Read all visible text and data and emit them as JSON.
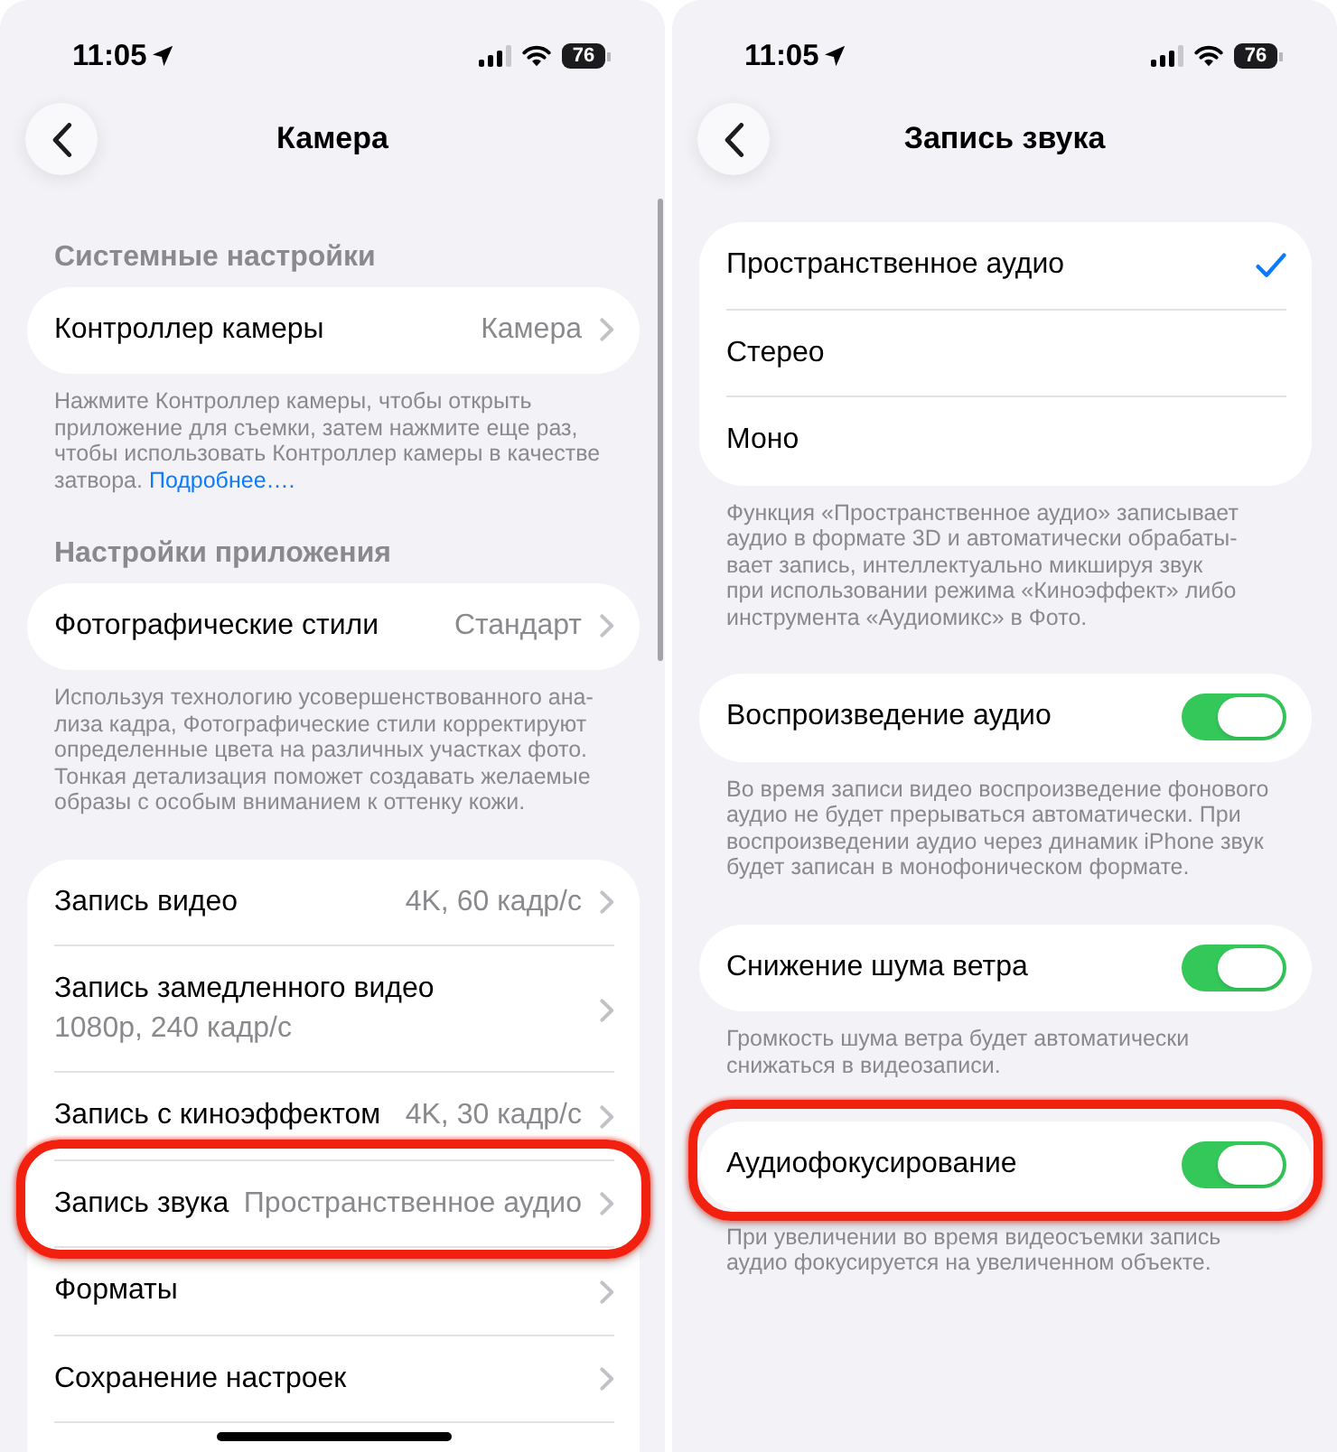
{
  "screens": [
    {
      "status_bar": {
        "time": "11:05",
        "battery": "76"
      },
      "nav": {
        "title": "Камера"
      },
      "groups": [
        {
          "header": "Системные настройки",
          "rows": [
            {
              "kind": "disclosure",
              "label": "Контроллер камеры",
              "value": "Камера",
              "highlighted": false
            }
          ],
          "footer": {
            "text": "Нажмите Контроллер камеры, чтобы открыть\nприложение для съемки, затем нажмите еще раз,\nчтобы использовать Контроллер камеры в качестве\nзатвора.",
            "link": "Подробнее…."
          }
        },
        {
          "header": "Настройки приложения",
          "rows": [
            {
              "kind": "disclosure",
              "label": "Фотографические стили",
              "value": "Стандарт",
              "highlighted": false
            }
          ],
          "footer": {
            "text": "Используя технологию усовершенствованного ана-\nлиза кадра, Фотографические стили корректируют\nопределенные цвета на различных участках фото.\nТонкая детализация поможет создавать желаемые\nобразы с особым вниманием к оттенку кожи."
          }
        },
        {
          "rows": [
            {
              "kind": "disclosure",
              "label": "Запись видео",
              "value": "4K, 60 кадр/с",
              "highlighted": false
            },
            {
              "kind": "disclosure",
              "label": "Запись замедленного видео",
              "detail": "1080p, 240 кадр/с",
              "highlighted": false
            },
            {
              "kind": "disclosure",
              "label": "Запись с киноэффектом",
              "value": "4K, 30 кадр/с",
              "highlighted": false
            },
            {
              "kind": "disclosure",
              "label": "Запись звука",
              "value": "Пространственное аудио",
              "highlighted": true
            },
            {
              "kind": "disclosure",
              "label": "Форматы",
              "highlighted": false
            },
            {
              "kind": "disclosure",
              "label": "Сохранение настроек",
              "highlighted": false
            }
          ]
        }
      ]
    },
    {
      "status_bar": {
        "time": "11:05",
        "battery": "76"
      },
      "nav": {
        "title": "Запись звука"
      },
      "groups": [
        {
          "rows": [
            {
              "kind": "option",
              "label": "Пространственное аудио",
              "selected": true,
              "highlighted": false
            },
            {
              "kind": "option",
              "label": "Стерео",
              "selected": false,
              "highlighted": false
            },
            {
              "kind": "option",
              "label": "Моно",
              "selected": false,
              "highlighted": false
            }
          ],
          "footer": {
            "text": "Функция «Пространственное аудио» записывает\nаудио в формате 3D и автоматически обрабаты-\nвает запись, интеллектуально микшируя звук\nпри использовании режима «Киноэффект» либо\nинструмента «Аудиомикс» в Фото."
          }
        },
        {
          "rows": [
            {
              "kind": "toggle",
              "label": "Воспроизведение аудио",
              "on": true,
              "highlighted": false
            }
          ],
          "footer": {
            "text": "Во время записи видео воспроизведение фонового\nаудио не будет прерываться автоматически. При\nвоспроизведении аудио через динамик iPhone звук\nбудет записан в монофоническом формате."
          }
        },
        {
          "rows": [
            {
              "kind": "toggle",
              "label": "Снижение шума ветра",
              "on": true,
              "highlighted": false
            }
          ],
          "footer": {
            "text": "Громкость шума ветра будет автоматически\nснижаться в видеозаписи."
          }
        },
        {
          "rows": [
            {
              "kind": "toggle",
              "label": "Аудиофокусирование",
              "on": true,
              "highlighted": true
            }
          ],
          "footer": {
            "text": "При увеличении во время видеосъемки запись\nаудио фокусируется на увеличенном объекте."
          }
        }
      ]
    }
  ]
}
